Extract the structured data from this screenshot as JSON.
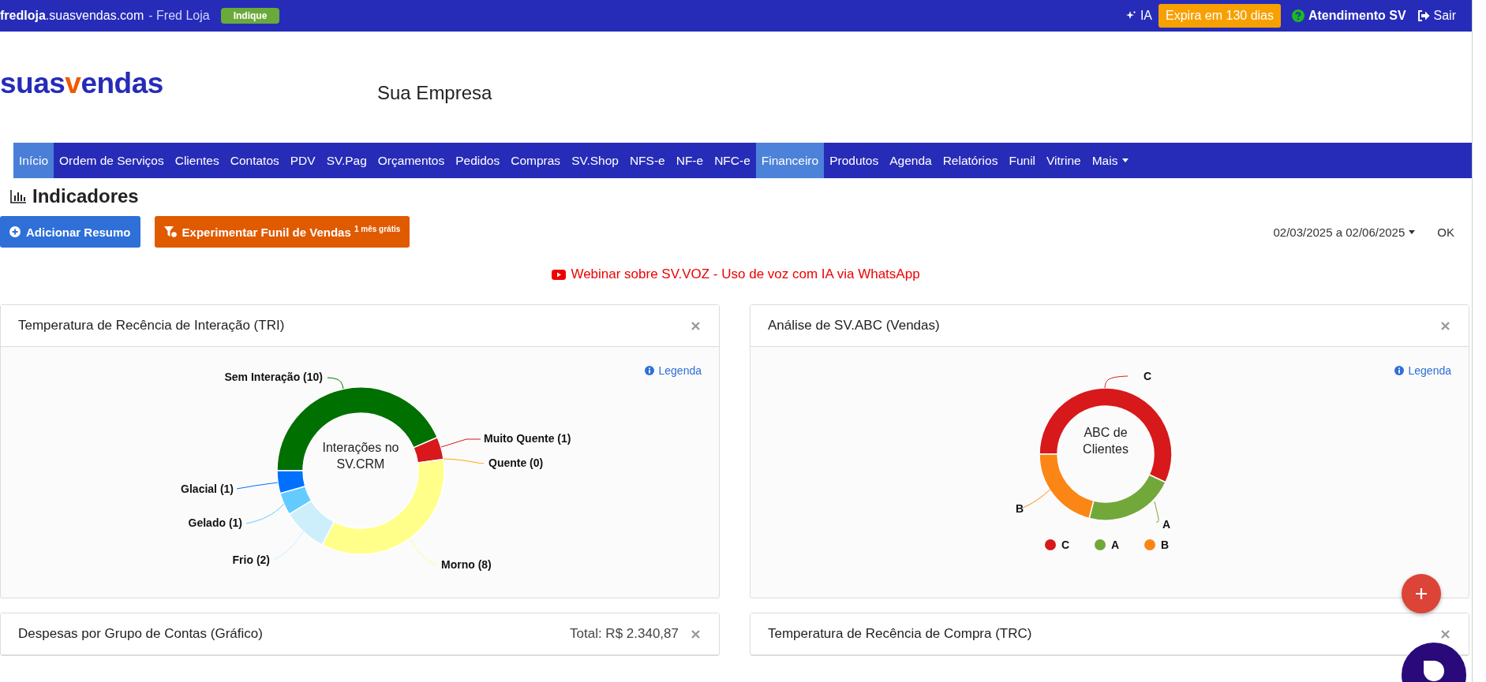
{
  "top_bar": {
    "site": "**fredloja**.suasvendas.com",
    "user": "- Fred Loja",
    "badge": "Indique",
    "ia": "IA",
    "expiry": "Expira em 130 dias",
    "support": "Atendimento SV",
    "logout": "Sair"
  },
  "header": {
    "logo_parts": [
      "suas",
      "v",
      "endas"
    ],
    "company": "Sua Empresa"
  },
  "nav": [
    {
      "label": "Início",
      "selected": true,
      "hovered": false
    },
    {
      "label": "Ordem de Serviços",
      "selected": false,
      "hovered": false
    },
    {
      "label": "Clientes",
      "selected": false,
      "hovered": false
    },
    {
      "label": "Contatos",
      "selected": false,
      "hovered": false
    },
    {
      "label": "PDV",
      "selected": false,
      "hovered": false
    },
    {
      "label": "SV.Pag",
      "selected": false,
      "hovered": false
    },
    {
      "label": "Orçamentos",
      "selected": false,
      "hovered": false
    },
    {
      "label": "Pedidos",
      "selected": false,
      "hovered": false
    },
    {
      "label": "Compras",
      "selected": false,
      "hovered": false
    },
    {
      "label": "SV.Shop",
      "selected": false,
      "hovered": false
    },
    {
      "label": "NFS-e",
      "selected": false,
      "hovered": false
    },
    {
      "label": "NF-e",
      "selected": false,
      "hovered": false
    },
    {
      "label": "NFC-e",
      "selected": false,
      "hovered": false
    },
    {
      "label": "Financeiro",
      "selected": false,
      "hovered": true
    },
    {
      "label": "Produtos",
      "selected": false,
      "hovered": false
    },
    {
      "label": "Agenda",
      "selected": false,
      "hovered": false
    },
    {
      "label": "Relatórios",
      "selected": false,
      "hovered": false
    },
    {
      "label": "Funil",
      "selected": false,
      "hovered": false
    },
    {
      "label": "Vitrine",
      "selected": false,
      "hovered": false
    },
    {
      "label": "Mais",
      "selected": false,
      "hovered": false,
      "dropdown": true
    }
  ],
  "page_title": "Indicadores",
  "toolbar": {
    "add_button": "Adicionar Resumo",
    "funnel_button": "Experimentar Funil de Vendas $^{1 mês grátis}$",
    "date_range": "02/03/2025 a 02/06/2025",
    "ok": "OK"
  },
  "webinar": "Webinar sobre SV.VOZ - Uso de voz com IA via WhatsApp",
  "cards": [
    {
      "kind": "tri",
      "title": "Temperatura de Recência de Interação (TRI)",
      "legend_link": "Legenda",
      "center_label": "Interações no SV.CRM",
      "chart_data": {
        "type": "donut",
        "categories": [
          "Sem Interação (10)",
          "Muito Quente (1)",
          "Quente (0)",
          "Morno (8)",
          "Frio (2)",
          "Gelado (1)",
          "Glacial (1)"
        ],
        "values": [
          10,
          1,
          0,
          8,
          2,
          1,
          1
        ]
      }
    },
    {
      "kind": "abc",
      "title": "Análise de SV.ABC (Vendas)",
      "legend_link": "Legenda",
      "center_label": "ABC de Clientes",
      "slice_labels": [
        "C",
        "A",
        "B"
      ],
      "legend": [
        {
          "label": "C",
          "color": "#d7191c"
        },
        {
          "label": "A",
          "color": "#72a83a"
        },
        {
          "label": "B",
          "color": "#fb8616"
        }
      ]
    },
    {
      "kind": "plain",
      "title": "Despesas por Grupo de Contas (Gráfico)",
      "total": "Total: R$ 2.340,87"
    },
    {
      "kind": "plain",
      "title": "Temperatura de Recência de Compra (TRC)"
    }
  ]
}
